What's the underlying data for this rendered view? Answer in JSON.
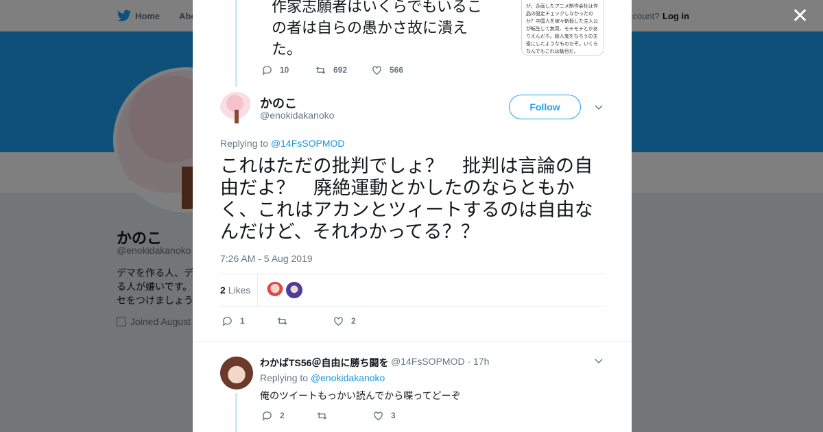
{
  "background": {
    "nav": {
      "home": "Home",
      "about": "Abo",
      "account": "ccount?",
      "login": "Log in"
    },
    "profile": {
      "name": "かのこ",
      "handle": "@enokidakanoko",
      "bio": "デマを作る人、デる人が嫌いです。セをつけましょう",
      "joined": "Joined August"
    }
  },
  "colors": {
    "brand": "#1da1f2",
    "link": "#1b95e0",
    "muted": "#657786"
  },
  "prev_tweet": {
    "text": "作家志願者はいくらでもいるこの者は自らの愚かさ故に潰えた。",
    "image_text": "が、企画したアニメ制作会社は作品の設定チェックしなかったのか？中国人を嫁々斬殺した主人公が転生して無双、モテモテとかありえんだろ。殺人鬼をなろうの主役にしたようなものだぞ。いくらなんでもこれは駄目だ。",
    "replies": "10",
    "retweets": "692",
    "likes": "566"
  },
  "main_tweet": {
    "name": "かのこ",
    "handle": "@enokidakanoko",
    "follow_label": "Follow",
    "replying_prefix": "Replying to ",
    "replying_to": "@14FsSOPMOD",
    "text": "これはただの批判でしょ？　批判は言論の自由だよ？　廃絶運動とかしたのならともかく、これはアカンとツィートするのは自由なんだけど、それわかってる？？",
    "time": "7:26 AM - 5 Aug 2019",
    "likes_count": "2",
    "likes_label": "Likes",
    "replies": "1",
    "likes": "2"
  },
  "reply_tweet": {
    "name": "わかばTS56＠自由に勝ち闘を",
    "handle": "@14FsSOPMOD",
    "age": "· 17h",
    "replying_prefix": "Replying to ",
    "replying_to": "@enokidakanoko",
    "text": "俺のツイートもっかい読んでから喋ってどーぞ",
    "replies": "2",
    "likes": "3"
  }
}
